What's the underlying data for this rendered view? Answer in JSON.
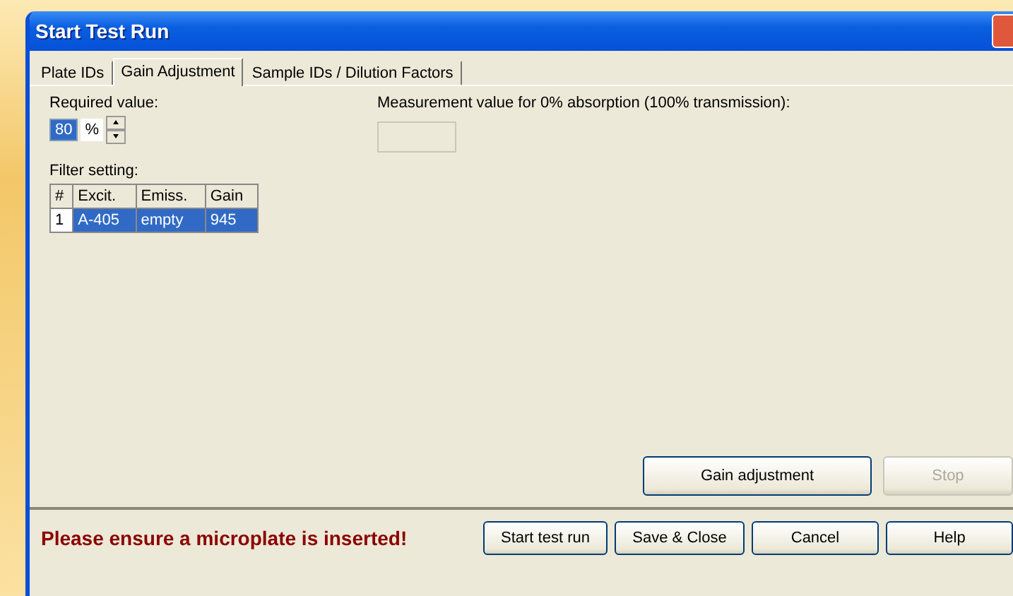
{
  "window": {
    "title": "Start Test Run"
  },
  "tabs": [
    {
      "label": "Plate IDs",
      "selected": false
    },
    {
      "label": "Gain Adjustment",
      "selected": true
    },
    {
      "label": "Sample IDs / Dilution Factors",
      "selected": false
    }
  ],
  "required_value": {
    "label": "Required value:",
    "value": "80",
    "value_selected": true,
    "unit": "%"
  },
  "measurement": {
    "label": "Measurement value for 0% absorption (100% transmission):",
    "value_disabled": true
  },
  "filter_setting": {
    "label": "Filter setting:",
    "columns": [
      "#",
      "Excit.",
      "Emiss.",
      "Gain"
    ],
    "rows": [
      {
        "cells": [
          "1",
          "A-405",
          "empty",
          "945"
        ],
        "selected": true
      }
    ]
  },
  "panel_buttons": [
    {
      "label": "Gain adjustment",
      "disabled": false
    },
    {
      "label": "Stop",
      "disabled": true
    }
  ],
  "warning": "Please ensure a microplate is inserted!",
  "footer_buttons": [
    {
      "label": "Start test run"
    },
    {
      "label": "Save & Close"
    },
    {
      "label": "Cancel"
    },
    {
      "label": "Help"
    }
  ]
}
